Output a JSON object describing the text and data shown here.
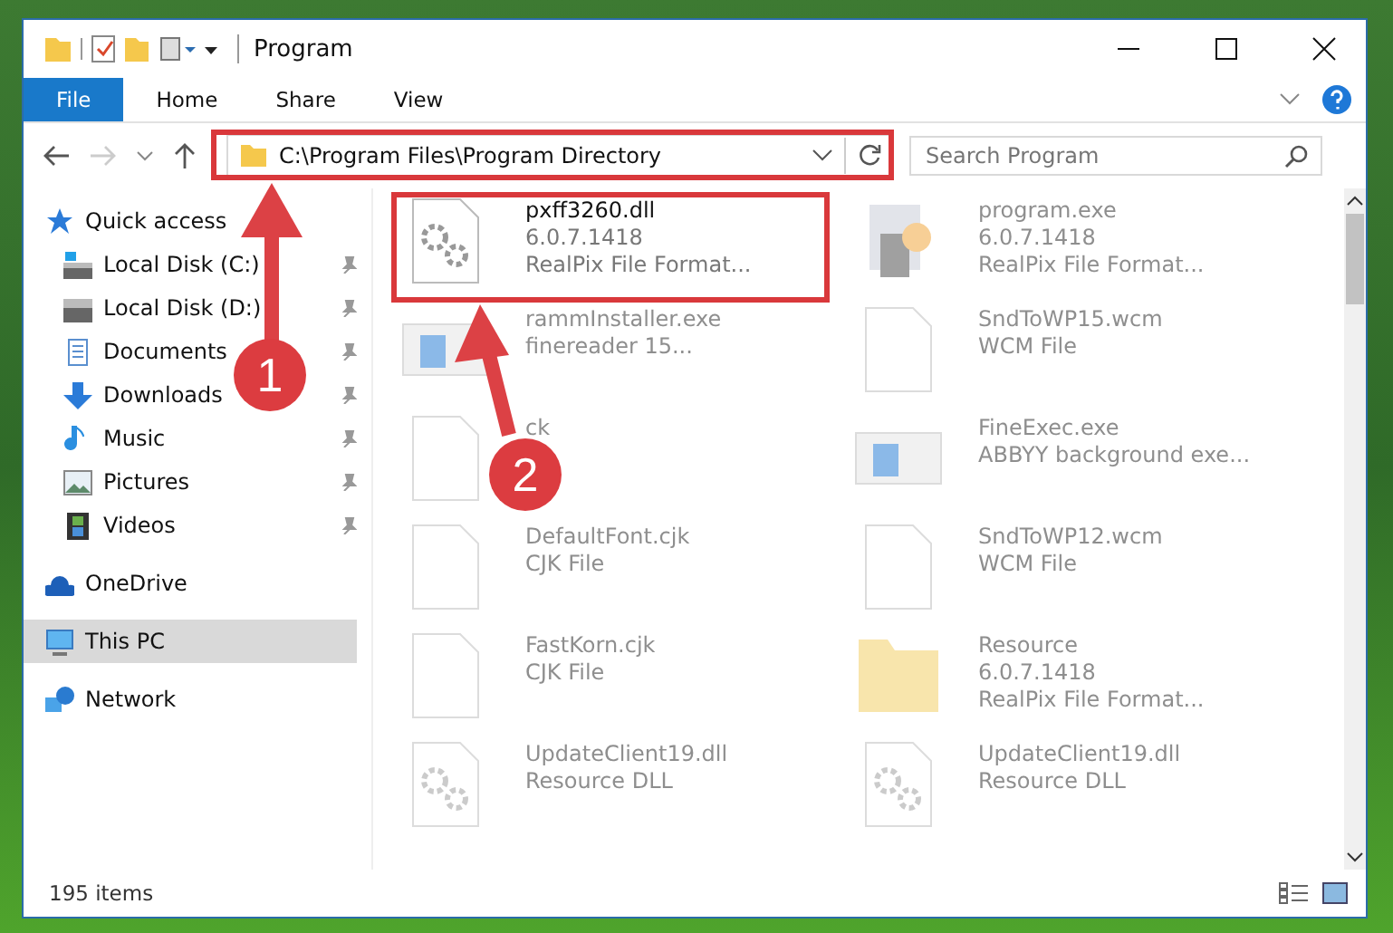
{
  "window": {
    "title": "Program"
  },
  "ribbon_tabs": [
    {
      "label": "File",
      "selected": true
    },
    {
      "label": "Home",
      "selected": false
    },
    {
      "label": "Share",
      "selected": false
    },
    {
      "label": "View",
      "selected": false
    }
  ],
  "address": {
    "path": "C:\\Program Files\\Program Directory"
  },
  "search": {
    "placeholder": "Search Program"
  },
  "sidebar": {
    "items": [
      {
        "label": "Quick access",
        "selected": false,
        "children": [
          {
            "label": "Local Disk (C:)",
            "pinned": true,
            "selected": false
          },
          {
            "label": "Local Disk (D:)",
            "pinned": true,
            "selected": false
          },
          {
            "label": "Documents",
            "pinned": true,
            "selected": false
          },
          {
            "label": "Downloads",
            "pinned": true,
            "selected": false
          },
          {
            "label": "Music",
            "pinned": true,
            "selected": false
          },
          {
            "label": "Pictures",
            "pinned": true,
            "selected": false
          },
          {
            "label": "Videos",
            "pinned": true,
            "selected": false
          }
        ]
      },
      {
        "label": "OneDrive",
        "selected": false
      },
      {
        "label": "This PC",
        "selected": true
      },
      {
        "label": "Network",
        "selected": false
      }
    ]
  },
  "files": [
    {
      "name": "pxff3260.dll",
      "details": [
        "6.0.7.1418",
        "RealPix File Format..."
      ],
      "kind": "library",
      "blurred": false,
      "highlighted": true
    },
    {
      "name": "program.exe",
      "details": [
        "6.0.7.1418",
        "RealPix File Format..."
      ],
      "kind": "program",
      "blurred": true,
      "highlighted": false
    },
    {
      "name": "rammInstaller.exe",
      "details": [
        "finereader 15..."
      ],
      "kind": "installer",
      "blurred": true,
      "highlighted": false
    },
    {
      "name": "SndToWP15.wcm",
      "details": [
        "WCM File"
      ],
      "kind": "document",
      "blurred": true,
      "highlighted": false
    },
    {
      "name": "ck",
      "kind": "document",
      "blurred": true,
      "highlighted": false
    },
    {
      "name": "FineExec.exe",
      "details": [
        "ABBYY background exe..."
      ],
      "kind": "installer",
      "blurred": true,
      "highlighted": false
    },
    {
      "name": "DefaultFont.cjk",
      "details": [
        "CJK File"
      ],
      "kind": "document",
      "blurred": true,
      "highlighted": false
    },
    {
      "name": "SndToWP12.wcm",
      "details": [
        "WCM File"
      ],
      "kind": "document",
      "blurred": true,
      "highlighted": false
    },
    {
      "name": "FastKorn.cjk",
      "details": [
        "CJK File"
      ],
      "kind": "document",
      "blurred": true,
      "highlighted": false
    },
    {
      "name": "Resource",
      "details": [
        "6.0.7.1418",
        "RealPix File Format..."
      ],
      "kind": "folder",
      "blurred": true,
      "highlighted": false
    },
    {
      "name": "UpdateClient19.dll",
      "details": [
        "Resource DLL"
      ],
      "kind": "library",
      "blurred": true,
      "highlighted": false
    },
    {
      "name": "UpdateClient19.dll",
      "details": [
        "Resource DLL"
      ],
      "kind": "library",
      "blurred": true,
      "highlighted": false
    }
  ],
  "status_bar": {
    "count": "195 items"
  },
  "annotations": [
    {
      "number": "1"
    },
    {
      "number": "2"
    }
  ]
}
